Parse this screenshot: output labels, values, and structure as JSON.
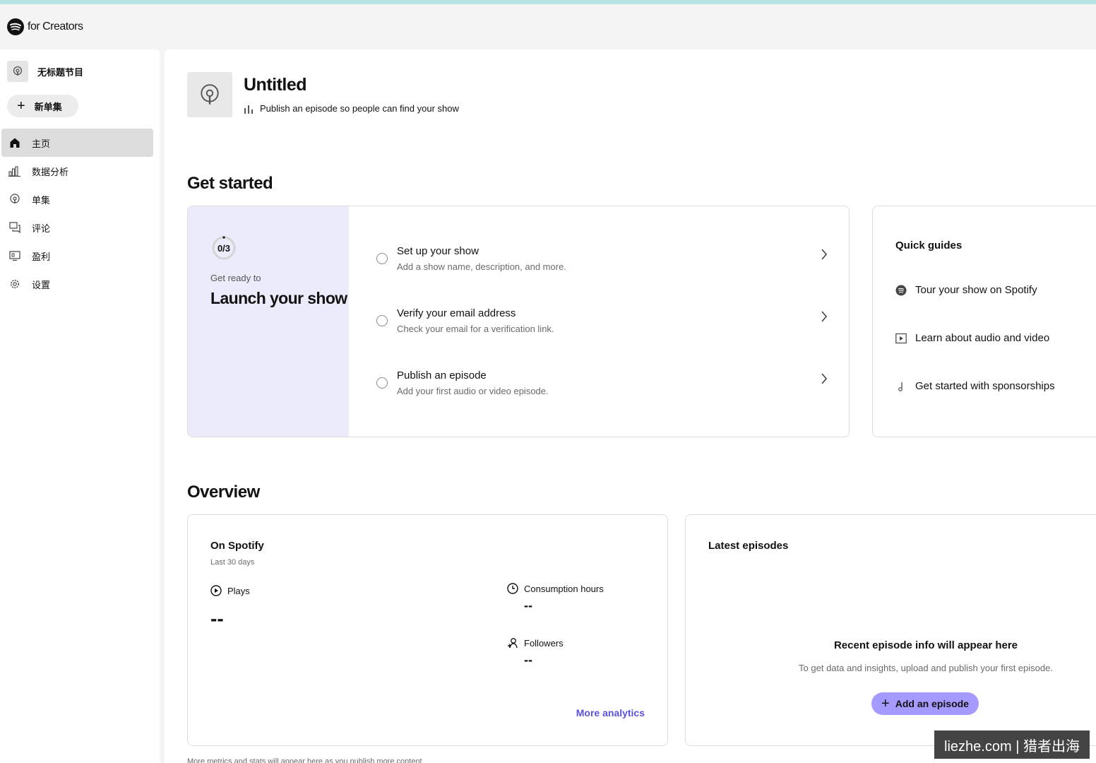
{
  "brand": {
    "name": "for Creators"
  },
  "sidebar": {
    "show_name": "无标题节目",
    "new_episode_label": "新单集",
    "items": [
      {
        "label": "主页",
        "icon": "home-icon",
        "active": true
      },
      {
        "label": "数据分析",
        "icon": "analytics-icon",
        "active": false
      },
      {
        "label": "单集",
        "icon": "episodes-icon",
        "active": false
      },
      {
        "label": "评论",
        "icon": "comments-icon",
        "active": false
      },
      {
        "label": "盈利",
        "icon": "monetization-icon",
        "active": false
      },
      {
        "label": "设置",
        "icon": "settings-icon",
        "active": false
      }
    ]
  },
  "header": {
    "title": "Untitled",
    "subtitle": "Publish an episode so people can find your show"
  },
  "get_started": {
    "title": "Get started",
    "progress_text": "0/3",
    "progress_fraction": 0,
    "ready_label": "Get ready to",
    "launch_label": "Launch your show",
    "tasks": [
      {
        "title": "Set up your show",
        "desc": "Add a show name, description, and more."
      },
      {
        "title": "Verify your email address",
        "desc": "Check your email for a verification link."
      },
      {
        "title": "Publish an episode",
        "desc": "Add your first audio or video episode."
      }
    ]
  },
  "quick_guides": {
    "title": "Quick guides",
    "items": [
      {
        "label": "Tour your show on Spotify",
        "icon": "spotify-icon"
      },
      {
        "label": "Learn about audio and video",
        "icon": "play-box-icon"
      },
      {
        "label": "Get started with sponsorships",
        "icon": "sponsorship-icon"
      }
    ]
  },
  "overview": {
    "title": "Overview",
    "on_spotify": {
      "title": "On Spotify",
      "range": "Last 30 days",
      "plays_label": "Plays",
      "plays_value": "--",
      "consumption_label": "Consumption hours",
      "consumption_value": "--",
      "followers_label": "Followers",
      "followers_value": "--",
      "more_link": "More analytics"
    },
    "latest": {
      "title": "Latest episodes",
      "empty_title": "Recent episode info will appear here",
      "empty_sub": "To get data and insights, upload and publish your first episode.",
      "add_label": "Add an episode"
    },
    "footnote": "More metrics and stats will appear here as you publish more content"
  },
  "watermark": "liezhe.com | 猎者出海",
  "colors": {
    "accent": "#a59aff",
    "link": "#5b52d6",
    "launch_panel": "#ebebfb"
  }
}
